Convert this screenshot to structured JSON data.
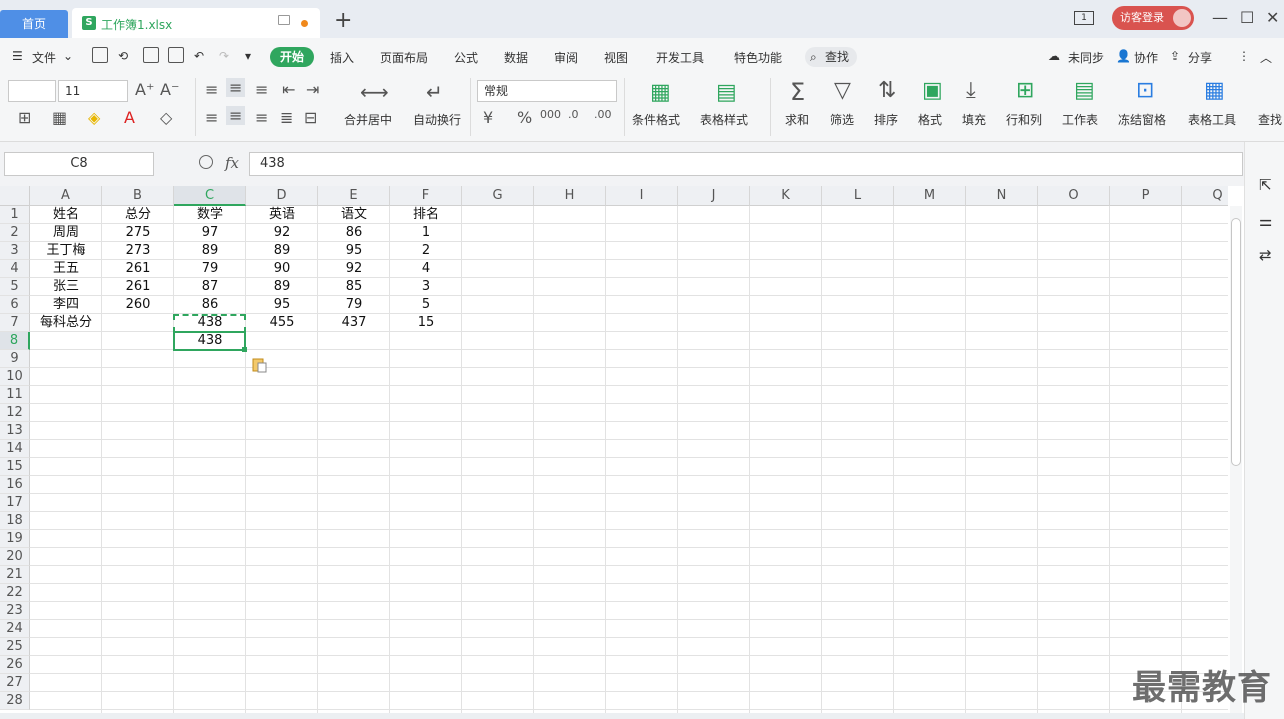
{
  "titlebar": {
    "home_tab": "首页",
    "file_tab": "工作簿1.xlsx",
    "file_icon": "S",
    "login": "访客登录",
    "window_count": "1"
  },
  "menu": {
    "file": "文件",
    "tabs": [
      "开始",
      "插入",
      "页面布局",
      "公式",
      "数据",
      "审阅",
      "视图",
      "开发工具",
      "特色功能"
    ],
    "search": "查找",
    "sync": "未同步",
    "collab": "协作",
    "share": "分享"
  },
  "ribbon": {
    "font_size": "11",
    "merge_center": "合并居中",
    "wrap_text": "自动换行",
    "number_format": "常规",
    "cond_format": "条件格式",
    "table_style": "表格样式",
    "sum": "求和",
    "filter": "筛选",
    "sort": "排序",
    "format": "格式",
    "fill": "填充",
    "row_col": "行和列",
    "worksheet": "工作表",
    "freeze": "冻结窗格",
    "table_tools": "表格工具",
    "find": "查找",
    "currency": "¥",
    "percent": "%",
    "thousands": "000"
  },
  "formula_bar": {
    "cell_ref": "C8",
    "fx": "fx",
    "value": "438"
  },
  "columns": [
    "A",
    "B",
    "C",
    "D",
    "E",
    "F",
    "G",
    "H",
    "I",
    "J",
    "K",
    "L",
    "M",
    "N",
    "O",
    "P",
    "Q"
  ],
  "rows": [
    "1",
    "2",
    "3",
    "4",
    "5",
    "6",
    "7",
    "8",
    "9",
    "10",
    "11",
    "12",
    "13",
    "14",
    "15",
    "16",
    "17",
    "18",
    "19",
    "20",
    "21",
    "22",
    "23",
    "24",
    "25",
    "26",
    "27",
    "28"
  ],
  "sheet": [
    [
      "姓名",
      "总分",
      "数学",
      "英语",
      "语文",
      "排名"
    ],
    [
      "周周",
      "275",
      "97",
      "92",
      "86",
      "1"
    ],
    [
      "王丁梅",
      "273",
      "89",
      "89",
      "95",
      "2"
    ],
    [
      "王五",
      "261",
      "79",
      "90",
      "92",
      "4"
    ],
    [
      "张三",
      "261",
      "87",
      "89",
      "85",
      "3"
    ],
    [
      "李四",
      "260",
      "86",
      "95",
      "79",
      "5"
    ],
    [
      "每科总分",
      "",
      "438",
      "455",
      "437",
      "15"
    ],
    [
      "",
      "",
      "438",
      "",
      "",
      ""
    ]
  ],
  "watermark": "最需教育",
  "colors": {
    "accent": "#2fa65e",
    "home_tab": "#4f8fe6",
    "login": "#d9534f"
  }
}
